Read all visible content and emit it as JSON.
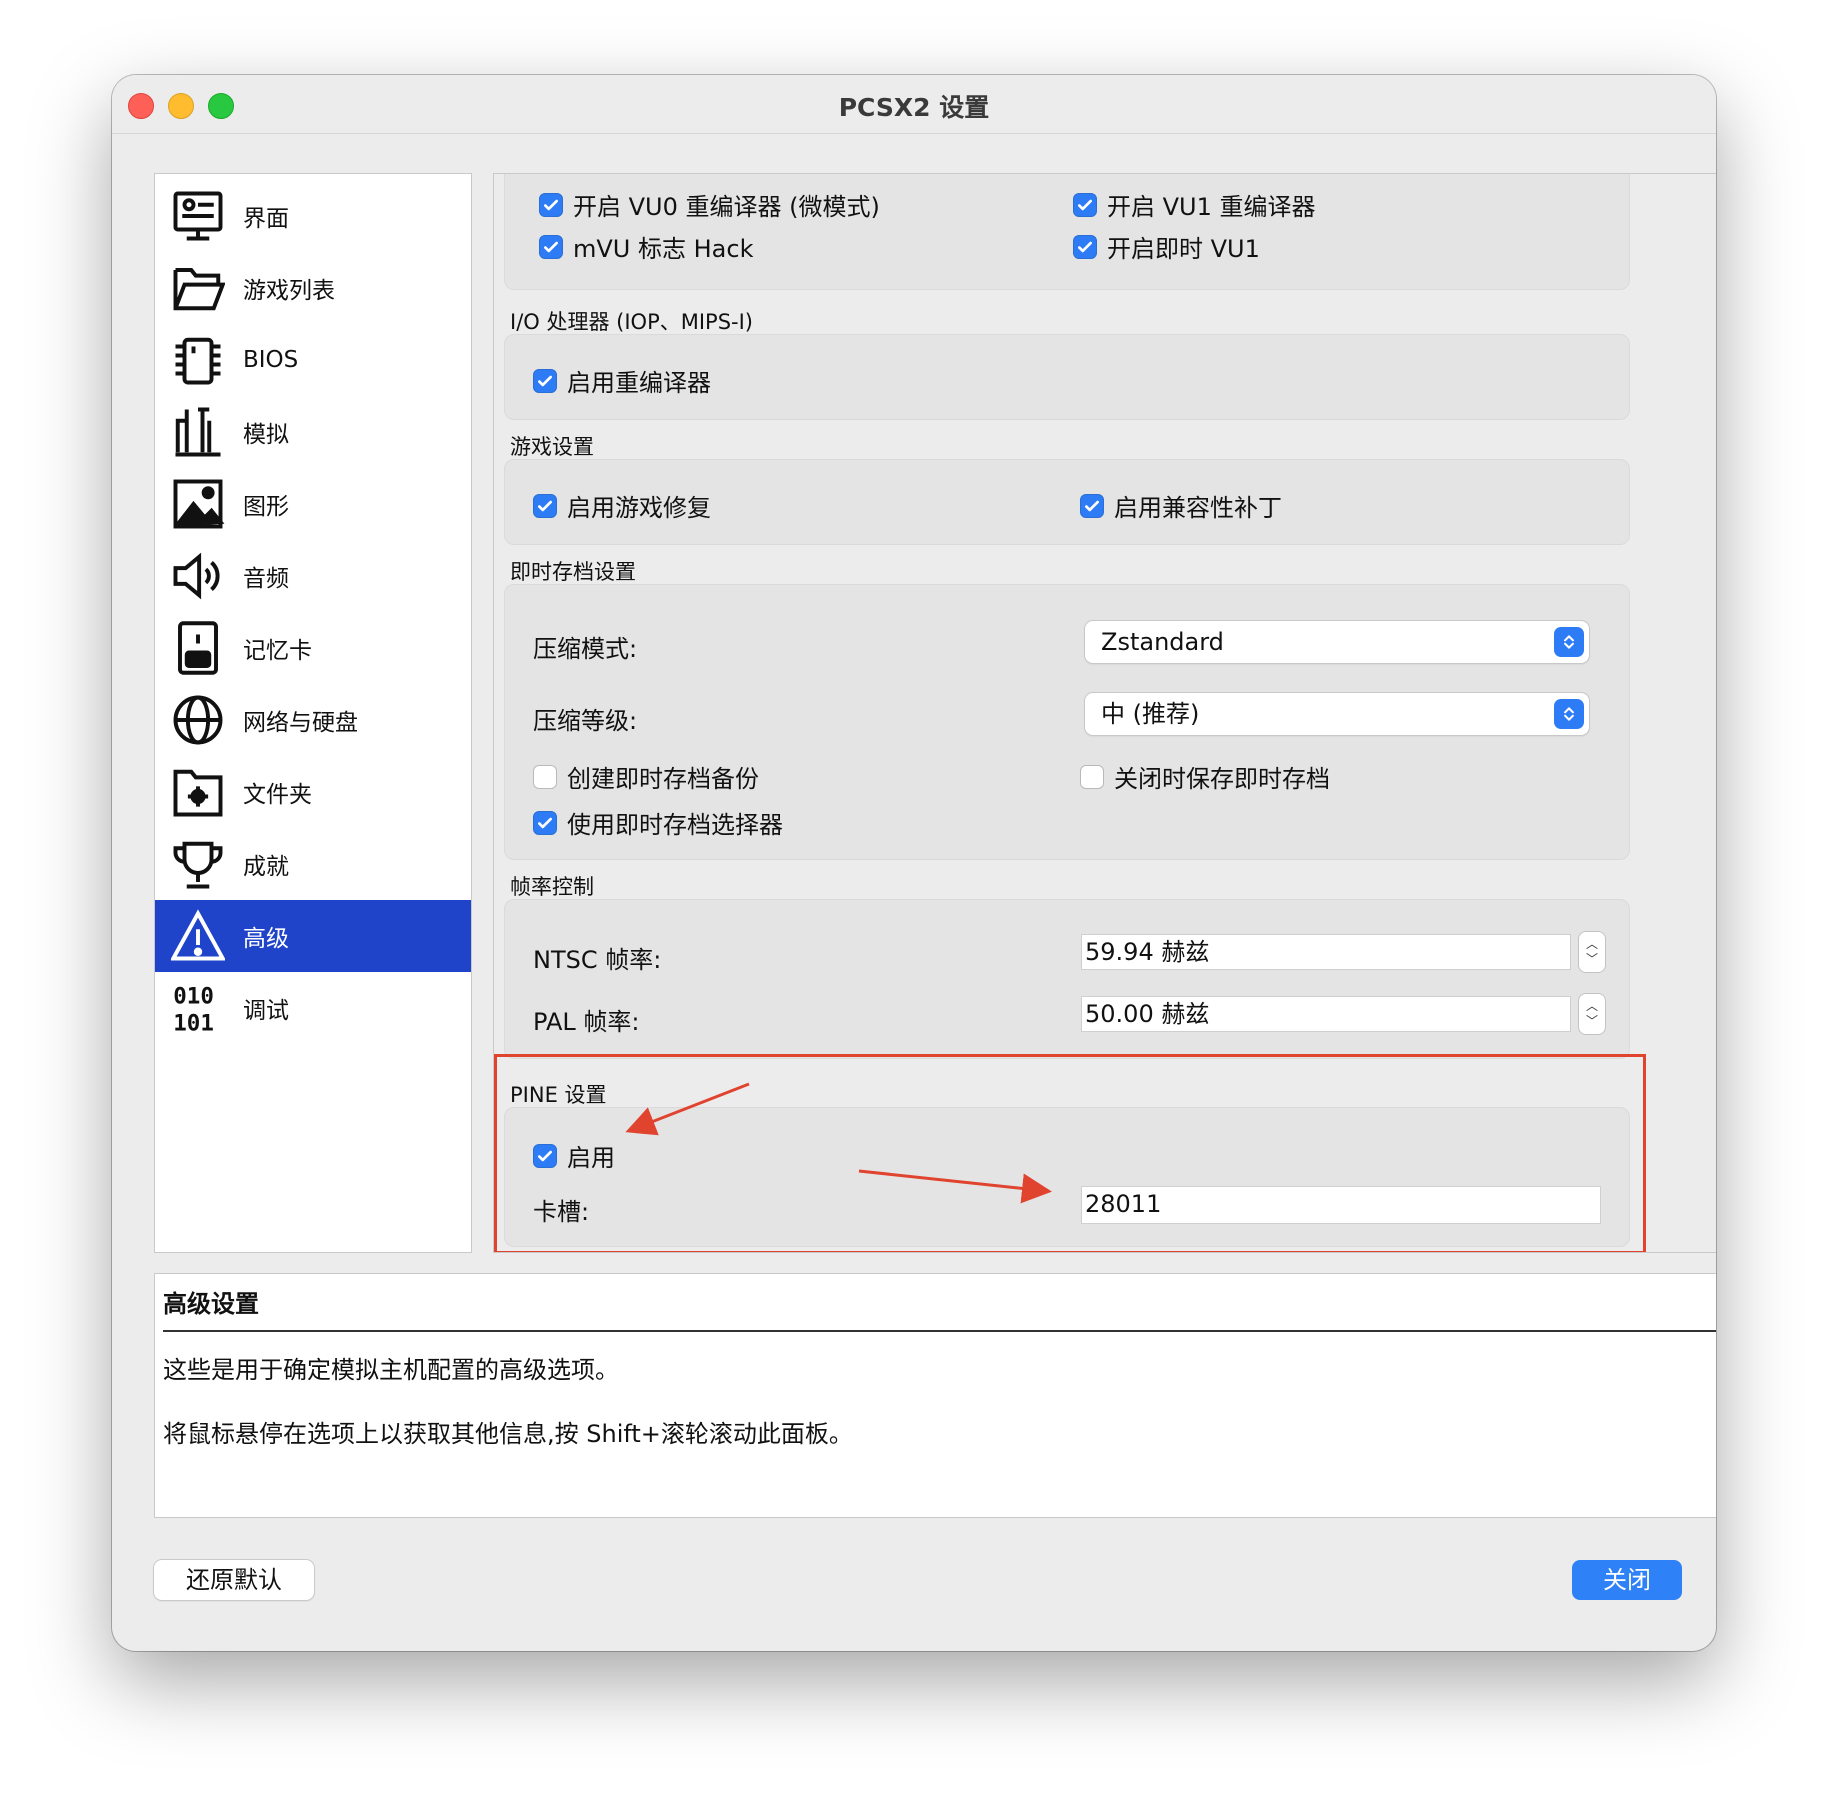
{
  "window": {
    "title": "PCSX2 设置"
  },
  "sidebar": {
    "items": [
      {
        "label": "界面",
        "icon": "interface-icon"
      },
      {
        "label": "游戏列表",
        "icon": "folder-open-icon"
      },
      {
        "label": "BIOS",
        "icon": "chip-icon"
      },
      {
        "label": "模拟",
        "icon": "pillars-icon"
      },
      {
        "label": "图形",
        "icon": "image-icon"
      },
      {
        "label": "音频",
        "icon": "speaker-icon"
      },
      {
        "label": "记忆卡",
        "icon": "memory-card-icon"
      },
      {
        "label": "网络与硬盘",
        "icon": "globe-icon"
      },
      {
        "label": "文件夹",
        "icon": "folder-gear-icon"
      },
      {
        "label": "成就",
        "icon": "trophy-icon"
      },
      {
        "label": "高级",
        "icon": "warning-icon",
        "active": true
      },
      {
        "label": "调试",
        "icon": "binary-icon"
      }
    ]
  },
  "vu": {
    "vu0": "开启 VU0 重编译器 (微模式)",
    "vu1": "开启 VU1 重编译器",
    "mvu_flag": "mVU 标志 Hack",
    "instant_vu1": "开启即时 VU1"
  },
  "iop": {
    "title": "I/O 处理器 (IOP、MIPS-I)",
    "recompiler": "启用重编译器"
  },
  "game": {
    "title": "游戏设置",
    "fixes": "启用游戏修复",
    "compat": "启用兼容性补丁"
  },
  "savestate": {
    "title": "即时存档设置",
    "compression_mode_label": "压缩模式:",
    "compression_mode_value": "Zstandard",
    "compression_level_label": "压缩等级:",
    "compression_level_value": "中 (推荐)",
    "backup": "创建即时存档备份",
    "save_on_close": "关闭时保存即时存档",
    "selector": "使用即时存档选择器"
  },
  "framerate": {
    "title": "帧率控制",
    "ntsc_label": "NTSC 帧率:",
    "ntsc_value": "59.94 赫兹",
    "pal_label": "PAL 帧率:",
    "pal_value": "50.00 赫兹"
  },
  "pine": {
    "title": "PINE 设置",
    "enable": "启用",
    "slot_label": "卡槽:",
    "slot_value": "28011"
  },
  "description": {
    "title": "高级设置",
    "line1": "这些是用于确定模拟主机配置的高级选项。",
    "line2": "将鼠标悬停在选项上以获取其他信息,按 Shift+滚轮滚动此面板。"
  },
  "buttons": {
    "restore": "还原默认",
    "close": "关闭"
  },
  "colors": {
    "accent": "#2d7cf6",
    "sidebar_active": "#1f43c9",
    "annotation": "#e0432e"
  }
}
